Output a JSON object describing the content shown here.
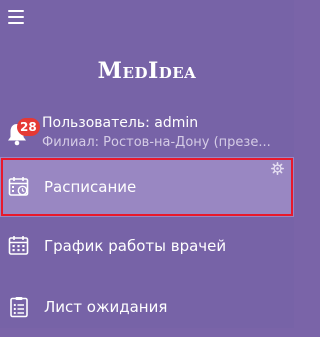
{
  "app": {
    "logo": "MedIdea"
  },
  "user": {
    "name_line": "Пользователь: admin",
    "branch_line": "Филиал: Ростов-на-Дону (презе...",
    "notifications_count": "28"
  },
  "nav": {
    "items": [
      {
        "label": "Расписание",
        "icon": "calendar-clock-icon",
        "active": true
      },
      {
        "label": "График работы врачей",
        "icon": "calendar-grid-icon",
        "active": false
      },
      {
        "label": "Лист ожидания",
        "icon": "clipboard-list-icon",
        "active": false
      }
    ]
  },
  "colors": {
    "sidebar_bg": "#7763a7",
    "active_item_bg": "#9987c2",
    "badge_bg": "#e53935",
    "highlight_border": "#e8192c"
  }
}
